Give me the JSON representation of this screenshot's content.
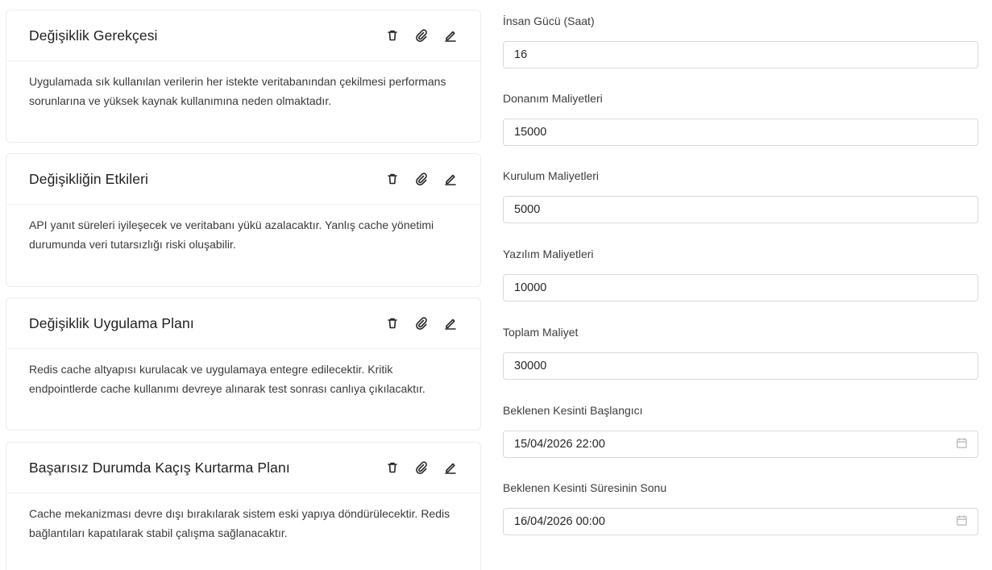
{
  "cards": [
    {
      "title": "Değişiklik Gerekçesi",
      "body": "Uygulamada sık kullanılan verilerin her istekte veritabanından çekilmesi performans sorunlarına ve yüksek kaynak kullanımına neden olmaktadır."
    },
    {
      "title": "Değişikliğin Etkileri",
      "body": "API yanıt süreleri iyileşecek ve veritabanı yükü azalacaktır. Yanlış cache yönetimi durumunda veri tutarsızlığı riski oluşabilir."
    },
    {
      "title": "Değişiklik Uygulama Planı",
      "body": "Redis cache altyapısı kurulacak ve uygulamaya entegre edilecektir. Kritik endpointlerde cache kullanımı devreye alınarak test sonrası canlıya çıkılacaktır."
    },
    {
      "title": "Başarısız Durumda Kaçış Kurtarma Planı",
      "body": "Cache mekanizması devre dışı bırakılarak sistem eski yapıya döndürülecektir. Redis bağlantıları kapatılarak stabil çalışma sağlanacaktır."
    }
  ],
  "card_action_icons": [
    "trash-icon",
    "paperclip-icon",
    "edit-icon"
  ],
  "form": {
    "fields": [
      {
        "label": "İnsan Gücü (Saat)",
        "value": "16"
      },
      {
        "label": "Donanım Maliyetleri",
        "value": "15000"
      },
      {
        "label": "Kurulum Maliyetleri",
        "value": "5000"
      },
      {
        "label": "Yazılım Maliyetleri",
        "value": "10000"
      },
      {
        "label": "Toplam Maliyet",
        "value": "30000"
      },
      {
        "label": "Beklenen Kesinti Başlangıcı",
        "value": "15/04/2026 22:00",
        "icon": "calendar-icon"
      },
      {
        "label": "Beklenen Kesinti Süresinin Sonu",
        "value": "16/04/2026 00:00",
        "icon": "calendar-icon"
      }
    ]
  }
}
